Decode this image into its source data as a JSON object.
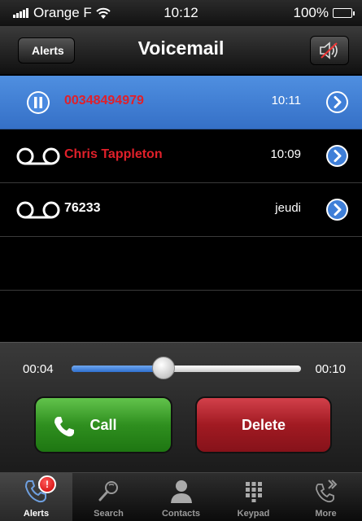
{
  "status_bar": {
    "carrier": "Orange F",
    "time": "10:12",
    "battery": "100%"
  },
  "nav": {
    "back_label": "Alerts",
    "title": "Voicemail",
    "mute_icon": "speaker-muted-icon"
  },
  "voicemails": [
    {
      "number": "00348494979",
      "time": "10:11",
      "state": "playing",
      "number_color": "#e0202a"
    },
    {
      "number": "Chris Tappleton",
      "time": "10:09",
      "state": "unheard",
      "number_color": "#e0202a"
    },
    {
      "number": "76233",
      "time": "jeudi",
      "state": "heard",
      "number_color": "#ffffff"
    }
  ],
  "player": {
    "elapsed": "00:04",
    "remaining": "00:10",
    "progress": 0.4
  },
  "actions": {
    "call_label": "Call",
    "delete_label": "Delete"
  },
  "tabs": [
    {
      "label": "Alerts",
      "icon": "voicemail-alert-icon",
      "selected": true,
      "badge": "!"
    },
    {
      "label": "Search",
      "icon": "search-contact-icon"
    },
    {
      "label": "Contacts",
      "icon": "person-icon"
    },
    {
      "label": "Keypad",
      "icon": "keypad-icon"
    },
    {
      "label": "More",
      "icon": "more-icon"
    }
  ],
  "colors": {
    "accent_blue": "#3f7fd8",
    "call_green": "#2f8f1f",
    "delete_red": "#a11a22",
    "unheard_red": "#e0202a"
  }
}
